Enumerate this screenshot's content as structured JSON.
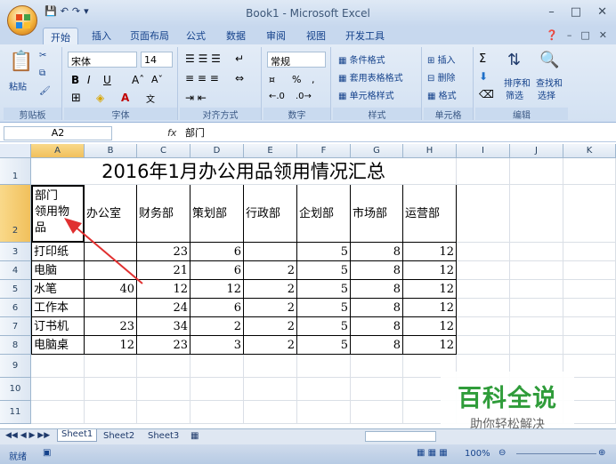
{
  "window": {
    "title": "Book1 - Microsoft Excel"
  },
  "tabs": [
    "开始",
    "插入",
    "页面布局",
    "公式",
    "数据",
    "审阅",
    "视图",
    "开发工具"
  ],
  "ribbon": {
    "clipboard": {
      "label": "剪贴板",
      "paste": "粘贴"
    },
    "font": {
      "label": "字体",
      "name": "宋体",
      "size": "14",
      "bold": "B",
      "italic": "I",
      "underline": "U"
    },
    "alignment": {
      "label": "对齐方式"
    },
    "number": {
      "label": "数字",
      "format": "常规",
      "percent": "%",
      "comma": ","
    },
    "styles": {
      "label": "样式",
      "conditional": "条件格式",
      "table": "套用表格格式",
      "cell": "单元格样式"
    },
    "cells": {
      "label": "单元格",
      "insert": "插入",
      "delete": "删除",
      "format": "格式"
    },
    "editing": {
      "label": "编辑",
      "sort": "排序和",
      "sort2": "筛选",
      "find": "查找和",
      "find2": "选择"
    }
  },
  "formula_bar": {
    "name_box": "A2",
    "fx": "fx",
    "content": "部门"
  },
  "columns": [
    "A",
    "B",
    "C",
    "D",
    "E",
    "F",
    "G",
    "H",
    "I",
    "J",
    "K"
  ],
  "rows": [
    "1",
    "2",
    "3",
    "4",
    "5",
    "6",
    "7",
    "8",
    "9",
    "10",
    "11"
  ],
  "sheet": {
    "title": "2016年1月办公用品领用情况汇总",
    "a2": [
      "部门",
      "领用物",
      "品"
    ],
    "headers": [
      "办公室",
      "财务部",
      "策划部",
      "行政部",
      "企划部",
      "市场部",
      "运营部"
    ],
    "data": [
      [
        "打印纸",
        "",
        "23",
        "6",
        "",
        "5",
        "8",
        "12"
      ],
      [
        "电脑",
        "",
        "21",
        "6",
        "2",
        "5",
        "8",
        "12"
      ],
      [
        "水笔",
        "40",
        "12",
        "12",
        "2",
        "5",
        "8",
        "12"
      ],
      [
        "工作本",
        "",
        "24",
        "6",
        "2",
        "5",
        "8",
        "12"
      ],
      [
        "订书机",
        "23",
        "34",
        "2",
        "2",
        "5",
        "8",
        "12"
      ],
      [
        "电脑桌",
        "12",
        "23",
        "3",
        "2",
        "5",
        "8",
        "12"
      ]
    ]
  },
  "sheet_tabs": [
    "Sheet1",
    "Sheet2",
    "Sheet3"
  ],
  "status": {
    "ready": "就绪",
    "zoom": "100%"
  },
  "watermark": {
    "main": "百科全说",
    "sub": "助你轻松解决"
  },
  "colors": {
    "arrow": "#e03030",
    "watermark": "#2f9c3a"
  }
}
